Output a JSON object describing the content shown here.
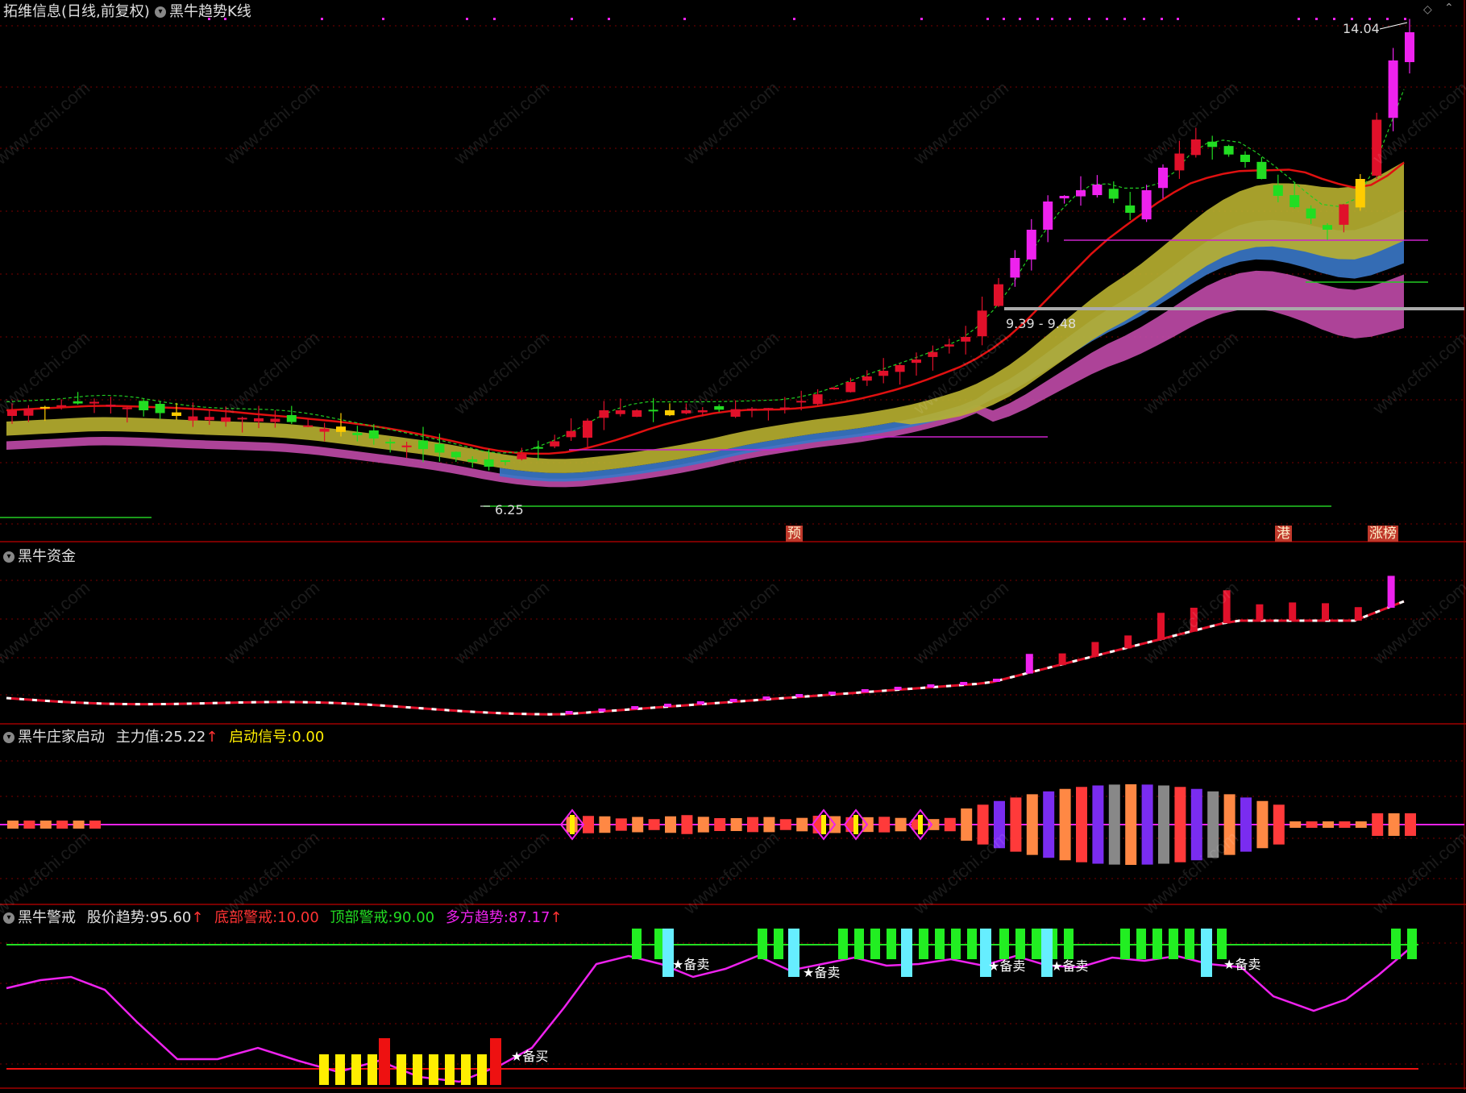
{
  "header": {
    "stock_title": "拓维信息(日线,前复权)",
    "indicator_name": "黑牛趋势K线"
  },
  "main_chart": {
    "high_label": "14.04",
    "range_label": "9.39 - 9.48",
    "low_label": "6.25",
    "markers": [
      "预",
      "港",
      "涨榜"
    ]
  },
  "panel_funds": {
    "title": "黑牛资金"
  },
  "panel_start": {
    "title": "黑牛庄家启动",
    "main_force_label": "主力值:",
    "main_force_value": "25.22",
    "signal_label": "启动信号:",
    "signal_value": "0.00"
  },
  "panel_alert": {
    "title": "黑牛警戒",
    "trend_label": "股价趋势:",
    "trend_value": "95.60",
    "bottom_label": "底部警戒:",
    "bottom_value": "10.00",
    "top_label": "顶部警戒:",
    "top_value": "90.00",
    "multi_label": "多方趋势:",
    "multi_value": "87.17",
    "buy_tag": "备买",
    "sell_tag": "备卖"
  },
  "colors": {
    "background": "#000000",
    "up": "#e0102a",
    "down": "#22dd22",
    "magenta": "#ee22ee",
    "yellow": "#ffee00",
    "cyan": "#66eeff",
    "grid": "#7a0000"
  },
  "watermark": "www.cfchi.com"
}
